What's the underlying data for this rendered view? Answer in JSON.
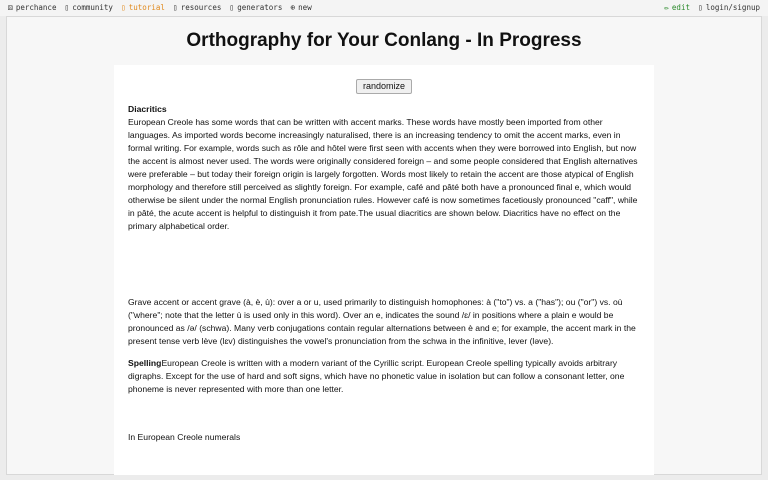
{
  "nav": {
    "left": [
      {
        "label": "perchance"
      },
      {
        "label": "community"
      },
      {
        "label": "tutorial"
      },
      {
        "label": "resources"
      },
      {
        "label": "generators"
      },
      {
        "label": "new"
      }
    ],
    "right": [
      {
        "label": "edit"
      },
      {
        "label": "login/signup"
      }
    ]
  },
  "page": {
    "title": "Orthography for Your Conlang - In Progress",
    "randomize_label": "randomize",
    "diacritics_heading": "Diacritics",
    "diacritics_text": "European Creole has some words that can be written with accent marks. These words have mostly been imported from other languages. As imported words become increasingly naturalised, there is an increasing tendency to omit the accent marks, even in formal writing. For example, words such as rôle and hôtel were first seen with accents when they were borrowed into English, but now the accent is almost never used. The words were originally considered foreign – and some people considered that English alternatives were preferable – but today their foreign origin is largely forgotten. Words most likely to retain the accent are those atypical of English morphology and therefore still perceived as slightly foreign. For example, café and pâté both have a pronounced final e, which would otherwise be silent under the normal English pronunciation rules. However café is now sometimes facetiously pronounced \"caff\", while in pâté, the acute accent is helpful to distinguish it from pate.The usual diacritics are shown below. Diacritics have no effect on the primary alphabetical order.",
    "grave_text": "Grave accent or accent grave (à, è, ù): over a or u, used primarily to distinguish homophones: à (\"to\") vs. a (\"has\"); ou (\"or\") vs. où (\"where\"; note that the letter ù is used only in this word). Over an e, indicates the sound /ɛ/ in positions where a plain e would be pronounced as /ə/ (schwa). Many verb conjugations contain regular alternations between è and e; for example, the accent mark in the present tense verb lève (lɛv) distinguishes the vowel's pronunciation from the schwa in the infinitive, lever (ləve).",
    "spelling_heading": "Spelling",
    "spelling_text": "European Creole is written with a modern variant of the Cyrillic script. European Creole spelling typically avoids arbitrary digraphs. Except for the use of hard and soft signs, which have no phonetic value in isolation but can follow a consonant letter, one phoneme is never represented with more than one letter.",
    "numerals_text": "In European Creole numerals"
  }
}
